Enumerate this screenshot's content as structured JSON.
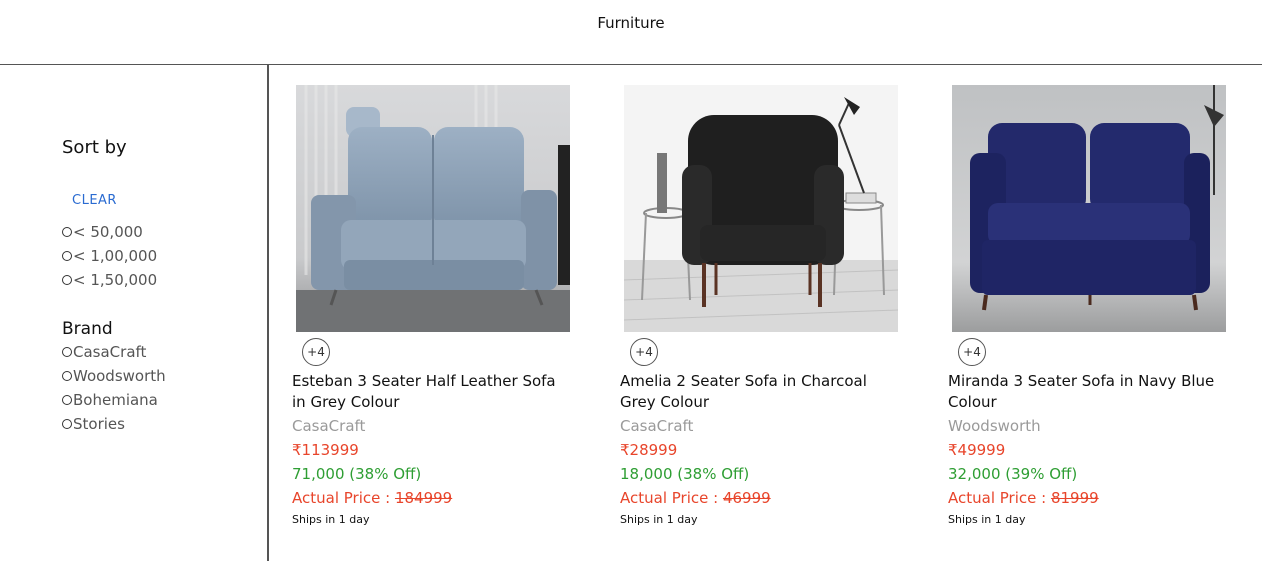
{
  "header": {
    "title": "Furniture"
  },
  "sidebar": {
    "sort_heading": "Sort by",
    "clear_label": "CLEAR",
    "price_options": [
      "< 50,000",
      "< 1,00,000",
      "< 1,50,000"
    ],
    "brand_heading": "Brand",
    "brand_options": [
      "CasaCraft",
      "Woodsworth",
      "Bohemiana",
      "Stories"
    ]
  },
  "products": [
    {
      "more_images": "+4",
      "title": "Esteban 3 Seater Half Leather Sofa in Grey Colour",
      "brand": "CasaCraft",
      "price": "₹113999",
      "discount": "71,000 (38% Off)",
      "actual_label": "Actual Price : ",
      "actual_price": "184999",
      "shipping": "Ships in 1 day"
    },
    {
      "more_images": "+4",
      "title": "Amelia 2 Seater Sofa in Charcoal Grey Colour",
      "brand": "CasaCraft",
      "price": "₹28999",
      "discount": "18,000 (38% Off)",
      "actual_label": "Actual Price : ",
      "actual_price": "46999",
      "shipping": "Ships in 1 day"
    },
    {
      "more_images": "+4",
      "title": "Miranda 3 Seater Sofa in Navy Blue Colour",
      "brand": "Woodsworth",
      "price": "₹49999",
      "discount": "32,000 (39% Off)",
      "actual_label": "Actual Price : ",
      "actual_price": "81999",
      "shipping": "Ships in 1 day"
    }
  ],
  "colors": {
    "accent_link": "#2a6bd1",
    "price_red": "#e8452b",
    "discount_green": "#2e9e33",
    "brand_grey": "#9a9a9a"
  }
}
